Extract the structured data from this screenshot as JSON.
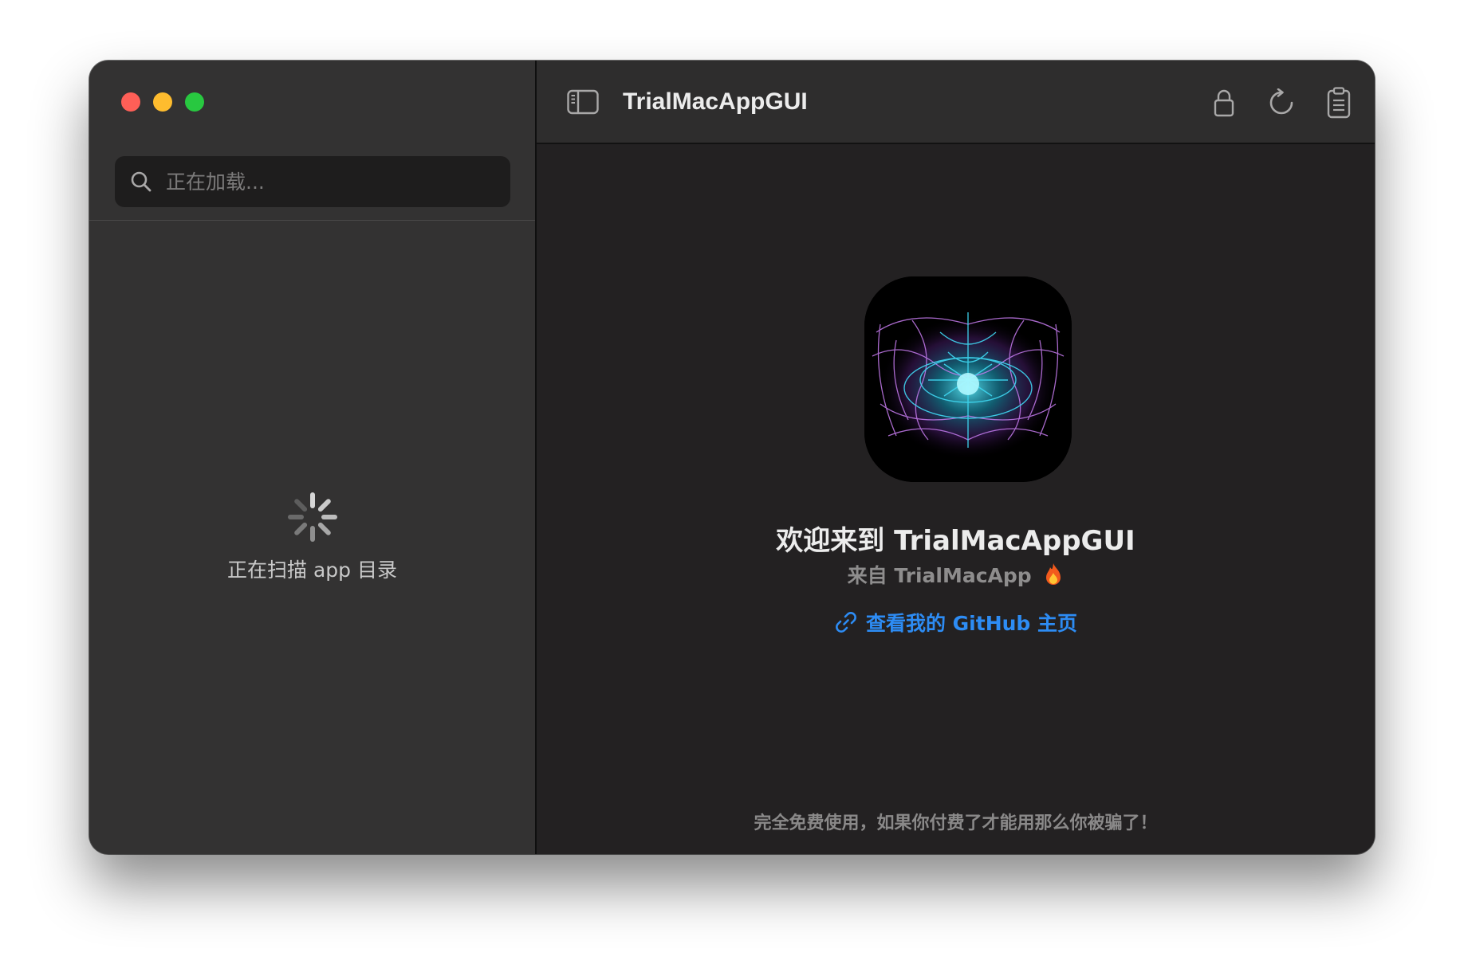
{
  "window": {
    "traffic_lights": [
      {
        "name": "close",
        "color": "#fe5f57"
      },
      {
        "name": "minimize",
        "color": "#febc2e"
      },
      {
        "name": "zoom",
        "color": "#28c840"
      }
    ]
  },
  "sidebar": {
    "search": {
      "placeholder": "正在加载...",
      "icon": "search-icon"
    },
    "loading_label": "正在扫描 app 目录"
  },
  "toolbar": {
    "title": "TrialMacAppGUI",
    "toggle_icon": "sidebar-toggle-icon",
    "actions": [
      "lock-icon",
      "refresh-icon",
      "clipboard-icon"
    ]
  },
  "main": {
    "app_icon": "app-icon",
    "welcome": "欢迎来到 TrialMacAppGUI",
    "from_text": "来自 TrialMacApp",
    "from_emoji": "fire-icon",
    "github_link": "查看我的 GitHub 主页",
    "footer_note": "完全免费使用，如果你付费了才能用那么你被骗了！"
  },
  "colors": {
    "accent_link": "#2d8cf4",
    "sidebar_bg": "#333232",
    "main_bg": "#232122"
  }
}
